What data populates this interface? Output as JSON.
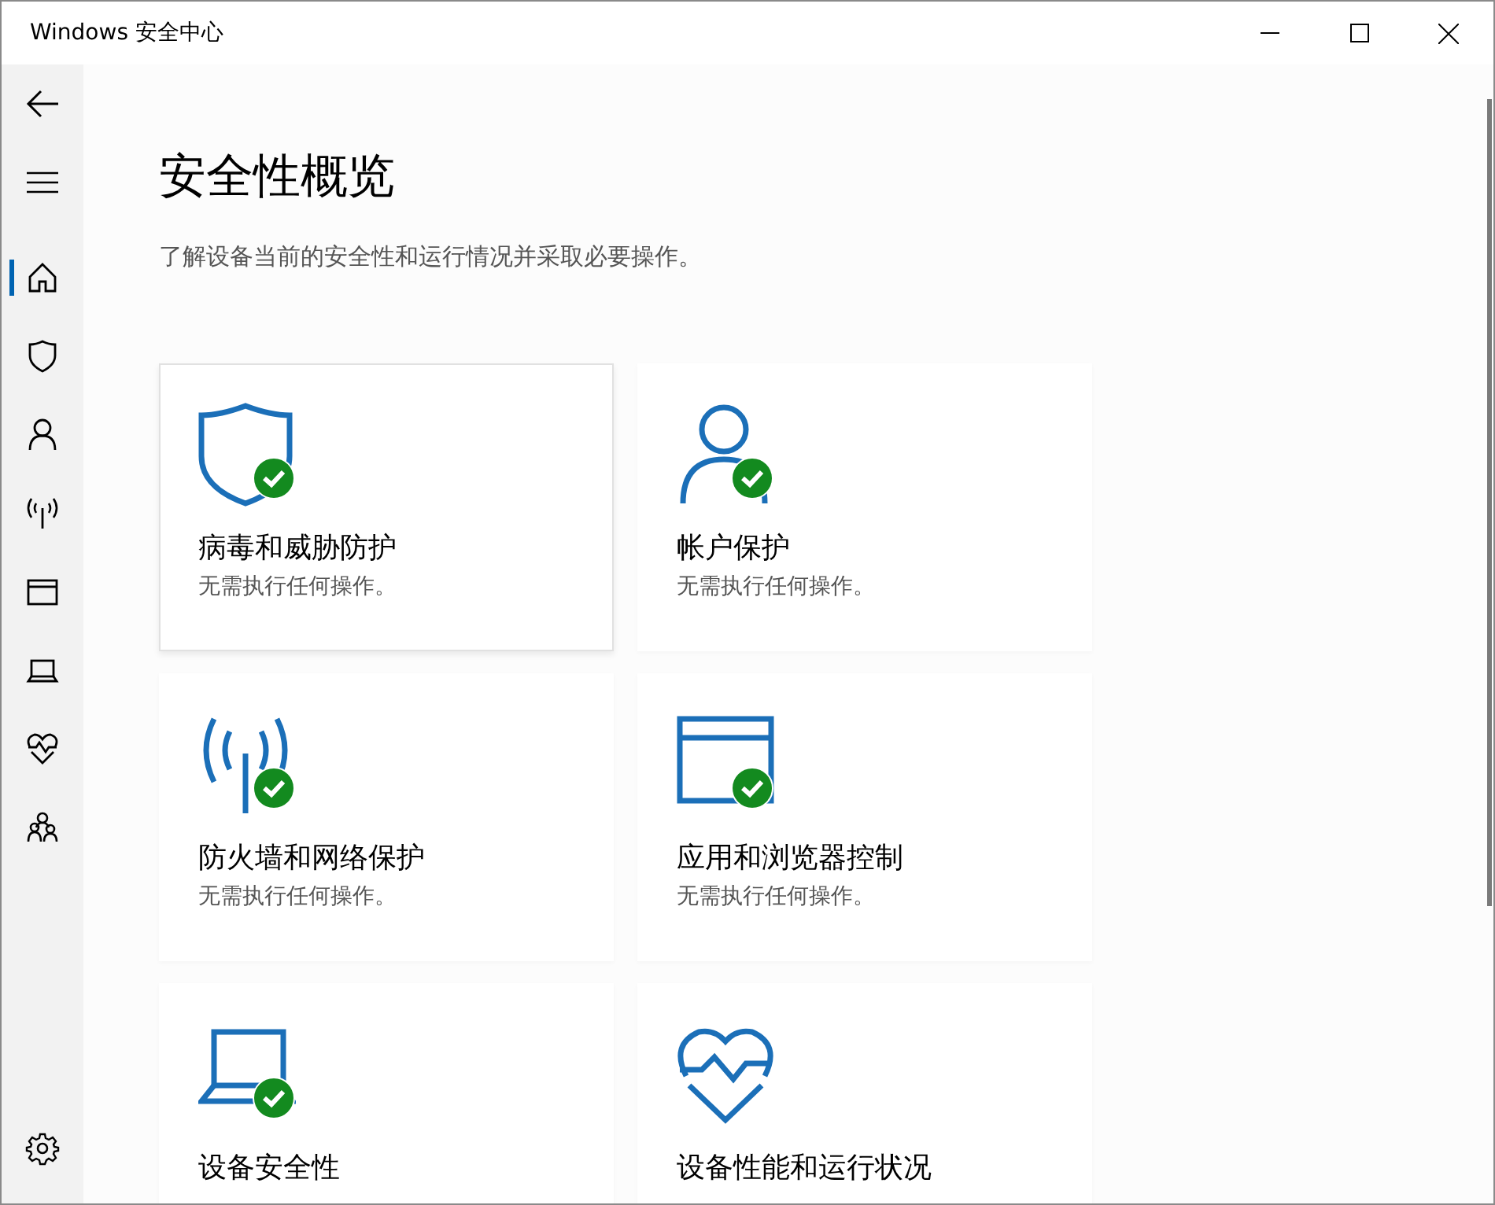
{
  "window": {
    "title": "Windows 安全中心"
  },
  "sidebar": {
    "items": [
      {
        "kind": "back",
        "selected": false
      },
      {
        "kind": "menu",
        "selected": false
      },
      {
        "kind": "home",
        "selected": true
      },
      {
        "kind": "shield",
        "selected": false
      },
      {
        "kind": "person",
        "selected": false
      },
      {
        "kind": "wireless",
        "selected": false
      },
      {
        "kind": "browser",
        "selected": false
      },
      {
        "kind": "laptop",
        "selected": false
      },
      {
        "kind": "heart",
        "selected": false
      },
      {
        "kind": "family",
        "selected": false
      }
    ],
    "bottom_items": [
      {
        "kind": "settings",
        "selected": false
      }
    ]
  },
  "page": {
    "heading": "安全性概览",
    "subtitle": "了解设备当前的安全性和运行情况并采取必要操作。"
  },
  "cards": [
    {
      "kind": "shield",
      "title": "病毒和威胁防护",
      "status": "无需执行任何操作。",
      "ok": true,
      "selected": true
    },
    {
      "kind": "person",
      "title": "帐户保护",
      "status": "无需执行任何操作。",
      "ok": true,
      "selected": false
    },
    {
      "kind": "wireless",
      "title": "防火墙和网络保护",
      "status": "无需执行任何操作。",
      "ok": true,
      "selected": false
    },
    {
      "kind": "browser",
      "title": "应用和浏览器控制",
      "status": "无需执行任何操作。",
      "ok": true,
      "selected": false
    },
    {
      "kind": "laptop",
      "title": "设备安全性",
      "ok": true,
      "selected": false
    },
    {
      "kind": "heart",
      "title": "设备性能和运行状况",
      "ok": false,
      "selected": false
    }
  ]
}
